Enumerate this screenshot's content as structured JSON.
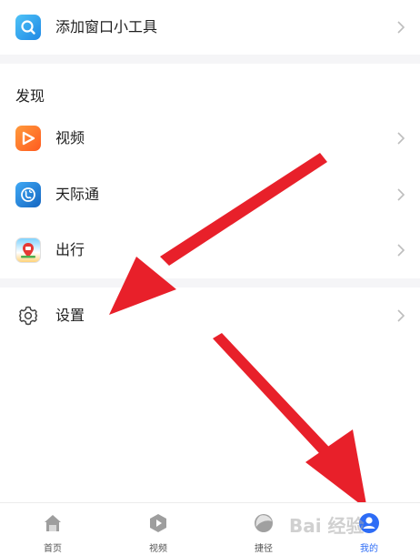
{
  "widget_row": {
    "label": "添加窗口小工具"
  },
  "discover": {
    "title": "发现",
    "items": [
      {
        "label": "视频"
      },
      {
        "label": "天际通"
      },
      {
        "label": "出行"
      }
    ]
  },
  "settings_row": {
    "label": "设置"
  },
  "tabbar": {
    "tabs": [
      {
        "label": "首页"
      },
      {
        "label": "视频"
      },
      {
        "label": "捷径"
      },
      {
        "label": "我的"
      }
    ]
  },
  "watermark": {
    "text": "Bai 经验"
  },
  "colors": {
    "accent": "#2d6cf6",
    "arrow": "#e8202a",
    "video_icon": "#ff7a1a",
    "separator": "#f5f5f7"
  }
}
